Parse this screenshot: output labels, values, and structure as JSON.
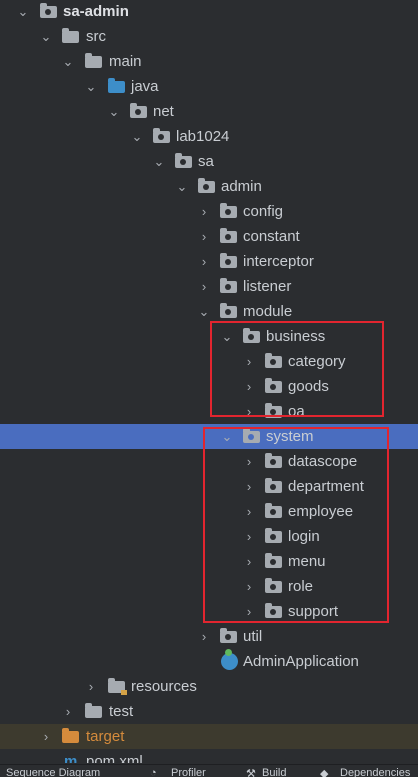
{
  "tree": {
    "root": "sa-admin",
    "src": "src",
    "main": "main",
    "java": "java",
    "net": "net",
    "lab1024": "lab1024",
    "sa": "sa",
    "admin": "admin",
    "config": "config",
    "constant": "constant",
    "interceptor": "interceptor",
    "listener": "listener",
    "module": "module",
    "business": "business",
    "category": "category",
    "goods": "goods",
    "oa": "oa",
    "system": "system",
    "datascope": "datascope",
    "department": "department",
    "employee": "employee",
    "login": "login",
    "menu": "menu",
    "role": "role",
    "support": "support",
    "util": "util",
    "admin_application": "AdminApplication",
    "resources": "resources",
    "test": "test",
    "target": "target",
    "pom": "pom.xml"
  },
  "bottom_tabs": [
    "Sequence Diagram",
    "Profiler",
    "Build",
    "Dependencies"
  ],
  "colors": {
    "background": "#2b2d30",
    "selection": "#4a6dbf",
    "highlight_box": "#e2252f",
    "excluded_folder": "#d58b3c"
  }
}
